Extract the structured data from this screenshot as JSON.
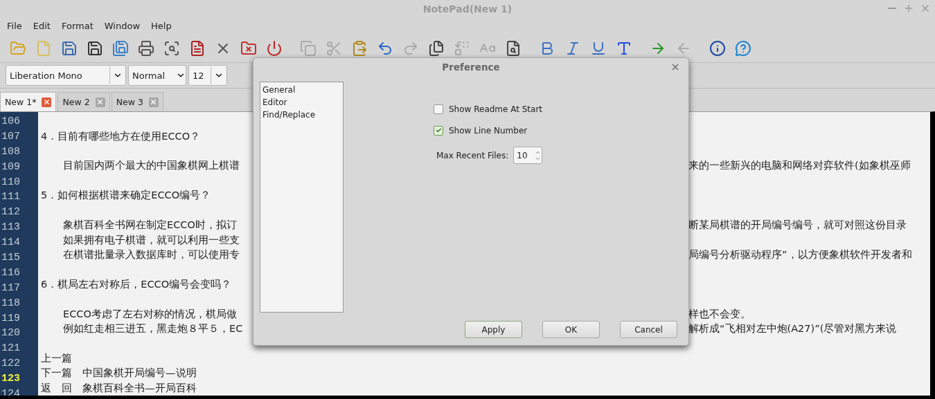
{
  "window": {
    "title": "NotePad(New 1)"
  },
  "menu": [
    "File",
    "Edit",
    "Format",
    "Window",
    "Help"
  ],
  "toolbar": [
    {
      "kind": "open",
      "disabled": false
    },
    {
      "kind": "new",
      "disabled": false
    },
    {
      "kind": "save",
      "disabled": false
    },
    {
      "kind": "save-as",
      "disabled": false
    },
    {
      "kind": "save-all",
      "disabled": false
    },
    {
      "kind": "print",
      "disabled": false
    },
    {
      "kind": "preview",
      "disabled": false
    },
    {
      "kind": "pdf",
      "disabled": false
    },
    {
      "kind": "close",
      "disabled": false
    },
    {
      "kind": "close-all",
      "disabled": false
    },
    {
      "kind": "exit",
      "disabled": false
    },
    {
      "kind": "copy",
      "disabled": true
    },
    {
      "kind": "cut",
      "disabled": true
    },
    {
      "kind": "paste",
      "disabled": false
    },
    {
      "kind": "undo",
      "disabled": false
    },
    {
      "kind": "redo",
      "disabled": true
    },
    {
      "kind": "duplicate",
      "disabled": false
    },
    {
      "kind": "replace",
      "disabled": true
    },
    {
      "kind": "case",
      "disabled": true
    },
    {
      "kind": "find",
      "disabled": false
    },
    {
      "kind": "bold",
      "disabled": false
    },
    {
      "kind": "italic",
      "disabled": false
    },
    {
      "kind": "underline",
      "disabled": false
    },
    {
      "kind": "font",
      "disabled": false
    },
    {
      "kind": "forward",
      "disabled": false
    },
    {
      "kind": "back",
      "disabled": true
    },
    {
      "kind": "info",
      "disabled": false
    },
    {
      "kind": "help",
      "disabled": false
    }
  ],
  "format_bar": {
    "font": "Liberation Mono",
    "style": "Normal",
    "size": "12"
  },
  "tabs": [
    {
      "label": "New 1*",
      "selected": true
    },
    {
      "label": "New 2",
      "selected": false
    },
    {
      "label": "New 3",
      "selected": false
    }
  ],
  "editor": {
    "lines": [
      {
        "number": "106",
        "current": false
      },
      {
        "number": "107",
        "current": false,
        "left": "4．目前有哪些地方在使用ECCO？",
        "indent": false
      },
      {
        "number": "108",
        "current": false
      },
      {
        "number": "109",
        "current": false,
        "left": "目前国内两个最大的中国象棋网上棋谱",
        "right": "来的一些新兴的电脑和网络对弈软件(如象棋巫师",
        "indent": true
      },
      {
        "number": "110",
        "current": false
      },
      {
        "number": "111",
        "current": false,
        "left": "5．如何根据棋谱来确定ECCO编号？",
        "indent": false
      },
      {
        "number": "112",
        "current": false
      },
      {
        "number": "113",
        "current": false,
        "left": "象棋百科全书网在制定ECCO时，拟订",
        "right": "断某局棋谱的开局编号编号，就可对照这份目录",
        "indent": true
      },
      {
        "number": "114",
        "current": false,
        "left": "如果拥有电子棋谱，就可以利用一些支",
        "indent": true
      },
      {
        "number": "115",
        "current": false,
        "left": "在棋谱批量录入数据库时，可以使用专",
        "right": "局编号分析驱动程序”，以方便象棋软件开发者和",
        "indent": true
      },
      {
        "number": "116",
        "current": false
      },
      {
        "number": "117",
        "current": false,
        "left": "6．棋局左右对称后，ECCO编号会变吗？",
        "indent": false
      },
      {
        "number": "118",
        "current": false
      },
      {
        "number": "119",
        "current": false,
        "left": "ECCO考虑了左右对称的情况，棋局做",
        "right": "样也不会变。",
        "indent": true
      },
      {
        "number": "120",
        "current": false,
        "left": "例如红走相三进五，黑走炮８平５，EC",
        "right": "解析成“飞相对左中炮(A27)”(尽管对黑方来说",
        "indent": true
      },
      {
        "number": "121",
        "current": false
      },
      {
        "number": "122",
        "current": false,
        "left": "上一篇",
        "indent": false
      },
      {
        "number": "123",
        "current": true,
        "left": "下一篇　中国象棋开局编号—说明",
        "indent": false
      },
      {
        "number": "124",
        "current": false,
        "left": "返　回　象棋百科全书—开局百科",
        "indent": false
      }
    ]
  },
  "dialog": {
    "title": "Preference",
    "pages": [
      {
        "label": "General",
        "selected": false
      },
      {
        "label": "Editor",
        "selected": false
      },
      {
        "label": "Find/Replace",
        "selected": false
      }
    ],
    "options": [
      {
        "label": "Show Readme At Start",
        "checked": false
      },
      {
        "label": "Show Line Number",
        "checked": true
      }
    ],
    "max_recent": {
      "label": "Max Recent Files:",
      "value": "10"
    },
    "buttons": [
      {
        "label": "Apply",
        "default": true
      },
      {
        "label": "OK",
        "default": false
      },
      {
        "label": "Cancel",
        "default": false
      }
    ]
  }
}
